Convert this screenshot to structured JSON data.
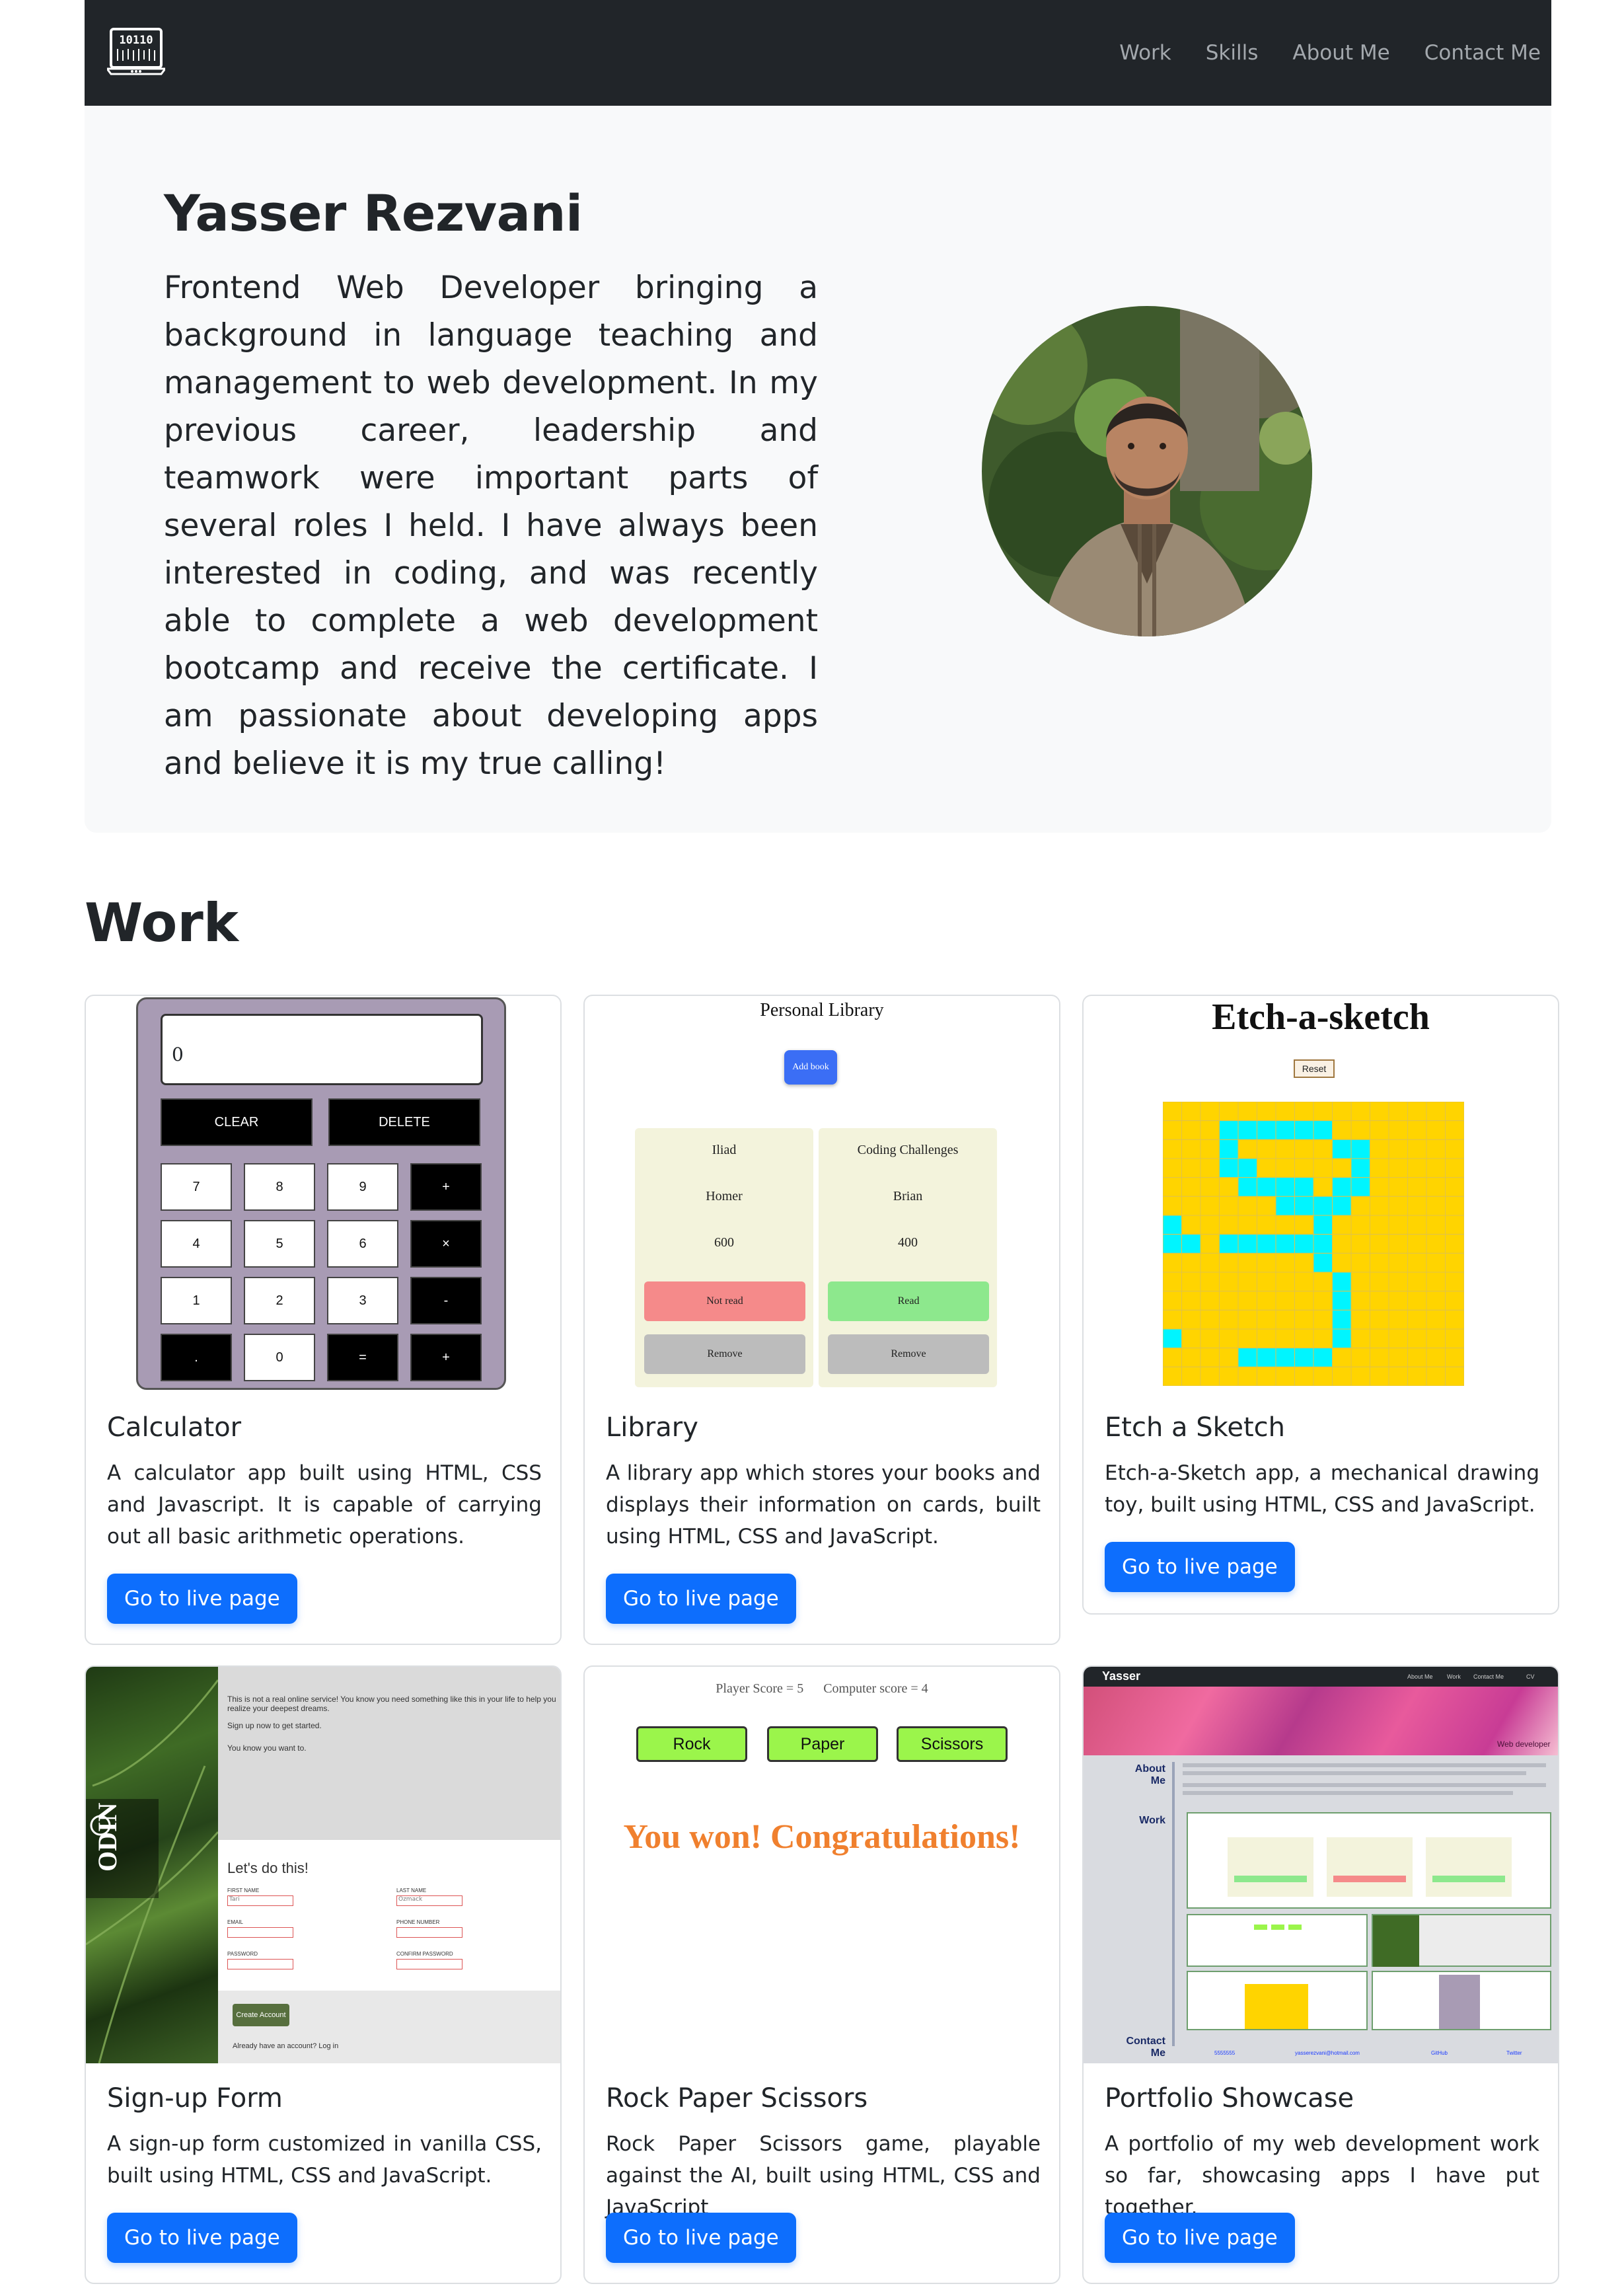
{
  "navbar": {
    "brand_text": "10110",
    "links": [
      "Work",
      "Skills",
      "About Me",
      "Contact Me"
    ]
  },
  "hero": {
    "name": "Yasser Rezvani",
    "bio": "Frontend Web Developer bringing a background in language teaching and management to web development. In my previous career, leadership and teamwork were important parts of several roles I held. I have always been interested in coding, and was recently able to complete a web development bootcamp and receive the certificate. I am passionate about developing apps and believe it is my true calling!"
  },
  "work": {
    "title": "Work",
    "button_label": "Go to live page",
    "cards": [
      {
        "title": "Calculator",
        "text": "A calculator app built using HTML, CSS and Javascript. It is capable of carrying out all basic arithmetic operations."
      },
      {
        "title": "Library",
        "text": "A library app which stores your books and displays their information on cards, built using HTML, CSS and JavaScript."
      },
      {
        "title": "Etch a Sketch",
        "text": "Etch-a-Sketch app, a mechanical drawing toy, built using HTML, CSS and JavaScript."
      },
      {
        "title": "Sign-up Form",
        "text": "A sign-up form customized in vanilla CSS, built using HTML, CSS and JavaScript."
      },
      {
        "title": "Rock Paper Scissors",
        "text": "Rock Paper Scissors game, playable against the AI, built using HTML, CSS and JavaScript"
      },
      {
        "title": "Portfolio Showcase",
        "text": "A portfolio of my web development work so far, showcasing apps I have put together."
      }
    ]
  },
  "previews": {
    "calculator": {
      "display": "0",
      "clear": "CLEAR",
      "delete": "DELETE",
      "keys": [
        "7",
        "8",
        "9",
        "+",
        "4",
        "5",
        "6",
        "×",
        "1",
        "2",
        "3",
        "-",
        ".",
        "0",
        "=",
        "+"
      ]
    },
    "library": {
      "title": "Personal Library",
      "add_button": "Add book",
      "books": [
        {
          "title": "Iliad",
          "author": "Homer",
          "pages": "600",
          "status": "Not read",
          "remove": "Remove"
        },
        {
          "title": "Coding Challenges",
          "author": "Brian",
          "pages": "400",
          "status": "Read",
          "remove": "Remove"
        }
      ]
    },
    "etch": {
      "title": "Etch-a-sketch",
      "reset": "Reset"
    },
    "signup": {
      "intro": "This is not a real online service! You know you need something like this in your life to help you realize your deepest dreams.",
      "line2": "Sign up now to get started.",
      "line3": "You know you want to.",
      "logo": "ODIN",
      "heading": "Let's do this!",
      "fields": [
        "FIRST NAME",
        "LAST NAME",
        "EMAIL",
        "PHONE NUMBER",
        "PASSWORD",
        "CONFIRM PASSWORD"
      ],
      "first_name_value": "Tari",
      "last_name_value": "Ozmack",
      "submit": "Create Account",
      "login_text": "Already have an account? Log in"
    },
    "rps": {
      "player_score": "Player Score = 5",
      "computer_score": "Computer score = 4",
      "buttons": [
        "Rock",
        "Paper",
        "Scissors"
      ],
      "result": "You won! Congratulations!"
    },
    "portfolio": {
      "brand": "Yasser",
      "nav": [
        "About Me",
        "Work",
        "Contact Me",
        "CV"
      ],
      "tagline": "Web developer",
      "about_label": "About Me",
      "work_label": "Work",
      "contact_label": "Contact Me",
      "contact_items": [
        "5555555",
        "yasserezvani@hotmail.com",
        "GitHub",
        "Twitter"
      ]
    }
  },
  "colors": {
    "navbar_bg": "#212529",
    "hero_bg": "#f8f9fa",
    "button_bg": "#0d6efd",
    "etch_fill": "#ffd400",
    "etch_draw": "#00f5ff"
  }
}
